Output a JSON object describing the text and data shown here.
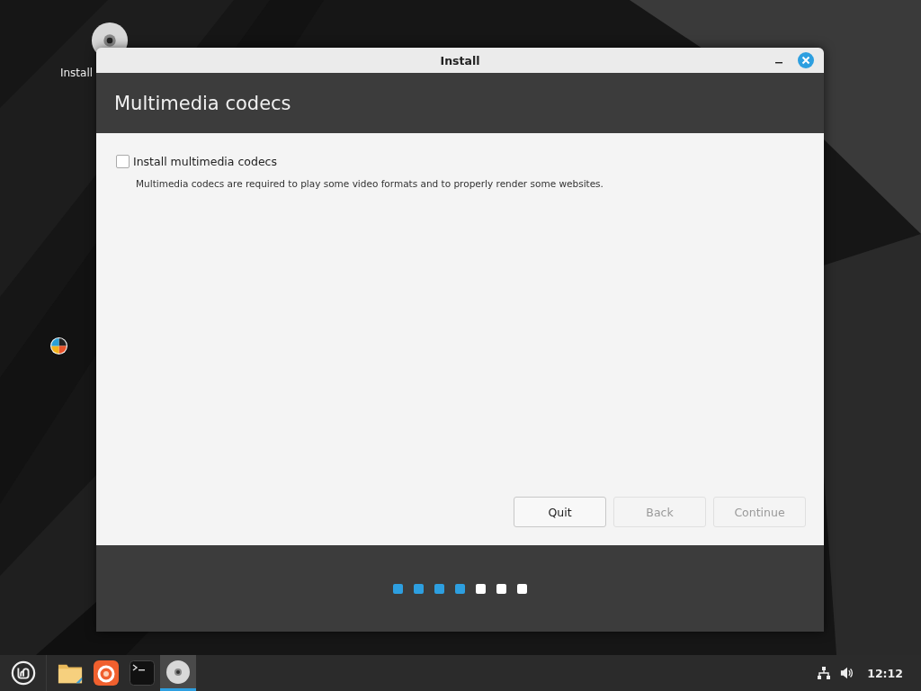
{
  "desktop": {
    "icons": [
      {
        "label": "Install"
      }
    ]
  },
  "window": {
    "title": "Install",
    "heading": "Multimedia codecs",
    "option": {
      "label": "Install multimedia codecs",
      "checked": false
    },
    "description": "Multimedia codecs are required to play some video formats and to properly render some websites.",
    "buttons": [
      {
        "label": "Quit",
        "disabled": false
      },
      {
        "label": "Back",
        "disabled": true
      },
      {
        "label": "Continue",
        "disabled": true
      }
    ],
    "steps": [
      {
        "done": true
      },
      {
        "done": true
      },
      {
        "done": true
      },
      {
        "done": true
      },
      {
        "done": false
      },
      {
        "done": false
      },
      {
        "done": false
      }
    ]
  },
  "taskbar": {
    "launchers": [
      {
        "kind": "menu",
        "selected": false
      },
      {
        "kind": "folder",
        "selected": false
      },
      {
        "kind": "browser",
        "selected": false
      },
      {
        "kind": "terminal",
        "selected": false
      },
      {
        "kind": "disc",
        "selected": true
      }
    ],
    "clock": "12:12"
  }
}
